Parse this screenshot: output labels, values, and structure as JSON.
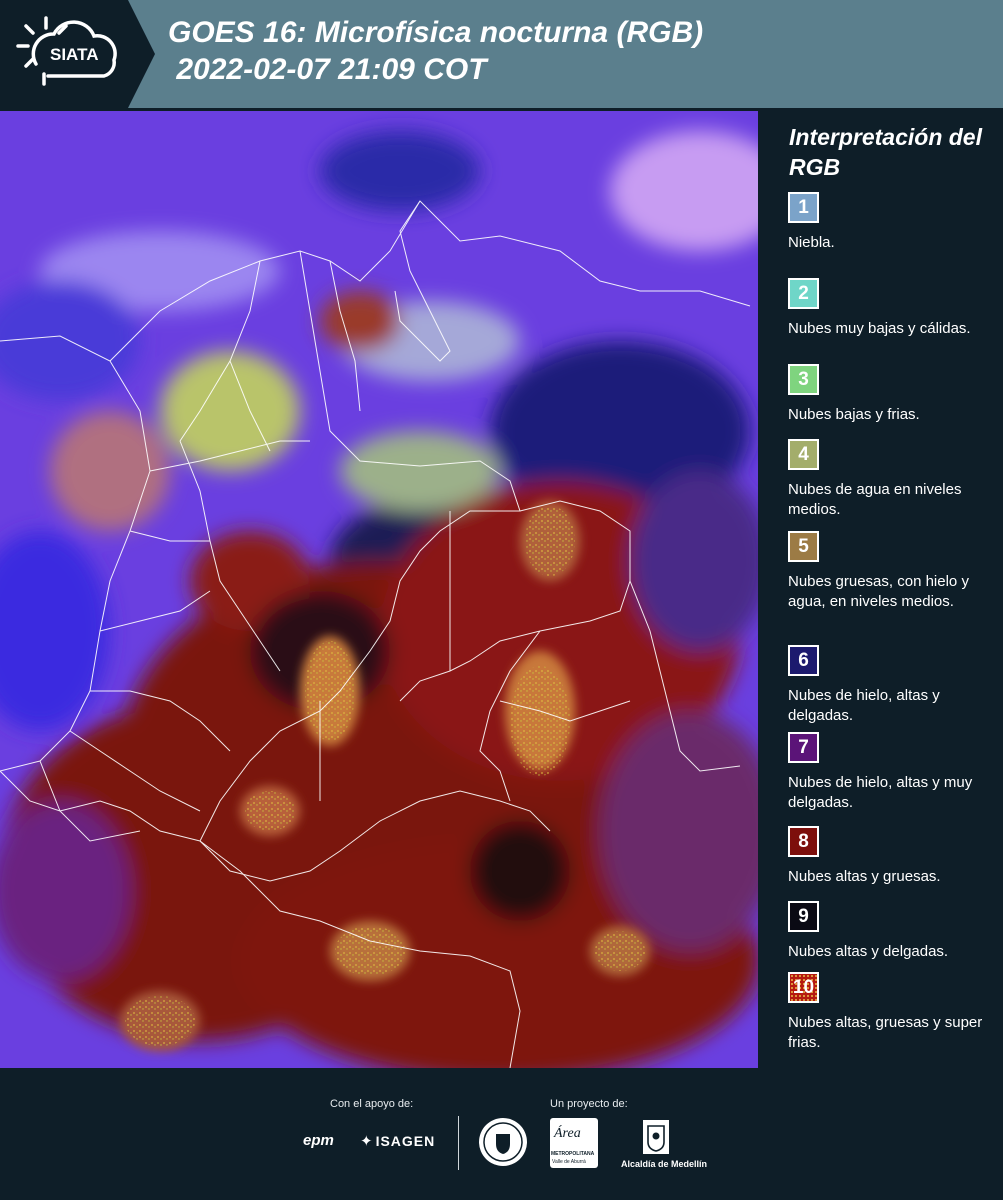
{
  "header": {
    "logo_text": "SIATA",
    "title_line1": "GOES 16: Microfísica nocturna (RGB)",
    "title_line2": " 2022-02-07 21:09 COT"
  },
  "legend": {
    "title": "Interpretación del RGB",
    "items": [
      {
        "num": "1",
        "label": "Niebla.",
        "color": "#7ba3c9"
      },
      {
        "num": "2",
        "label": "Nubes muy bajas y cálidas.",
        "color": "#6fd6c8"
      },
      {
        "num": "3",
        "label": "Nubes bajas y frias.",
        "color": "#7fd47f"
      },
      {
        "num": "4",
        "label": "Nubes de agua en niveles medios.",
        "color": "#a3ad6b"
      },
      {
        "num": "5",
        "label": "Nubes gruesas, con hielo y agua, en niveles medios.",
        "color": "#9c7b45"
      },
      {
        "num": "6",
        "label": "Nubes de hielo, altas y delgadas.",
        "color": "#1c1a6e"
      },
      {
        "num": "7",
        "label": "Nubes de hielo, altas y muy delgadas.",
        "color": "#5b1478"
      },
      {
        "num": "8",
        "label": "Nubes altas y gruesas.",
        "color": "#7d0f0c"
      },
      {
        "num": "9",
        "label": "Nubes altas y delgadas.",
        "color": "#0a0a14"
      },
      {
        "num": "10",
        "label": "Nubes altas, gruesas y super frias.",
        "color": "#b51a10"
      }
    ]
  },
  "footer": {
    "support_label": "Con el apoyo de:",
    "project_label": "Un proyecto de:",
    "epm": "epm",
    "isagen": "ISAGEN",
    "area_metro": "METROPOLITANA",
    "area_metro_sub": "Valle de Aburrá",
    "area_word": "Área",
    "alcaldia": "Alcaldía de Medellín"
  }
}
